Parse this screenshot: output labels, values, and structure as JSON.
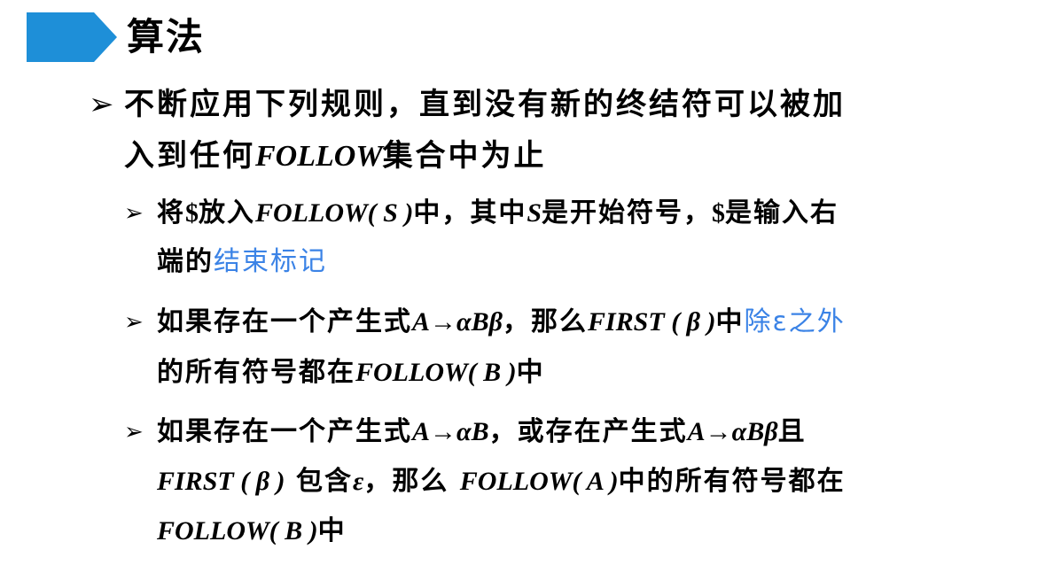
{
  "slide": {
    "title": "算法",
    "bullet_main": {
      "line1": "不断应用下列规则，直到没有新的终结符可以被加",
      "line2_a": "入到任何",
      "line2_follow": "FOLLOW",
      "line2_b": "集合中为止"
    },
    "rule1": {
      "a": "将",
      "dollar": "$",
      "b": "放入",
      "follow_s": "FOLLOW( S )",
      "c": "中，其中",
      "s": "S",
      "d": "是开始符号，",
      "dollar2": "$",
      "e": "是输入右",
      "f": "端的",
      "highlight": "结束标记"
    },
    "rule2": {
      "a": "如果存在一个产生式",
      "prod": "A→αBβ",
      "b": "，那么",
      "first": "FIRST ( β )",
      "c": "中",
      "highlight": "除ε之外",
      "d": "的所有符号都在",
      "follow_b": "FOLLOW( B )",
      "e": "中"
    },
    "rule3": {
      "a": "如果存在一个产生式",
      "prod1": "A→αB",
      "b": "，或存在产生式",
      "prod2": "A→αBβ",
      "c": "且",
      "first": "FIRST ( β )",
      "d": "包含",
      "eps": "ε",
      "e": "，那么 ",
      "follow_a": "FOLLOW( A )",
      "f": "中的所有符号都在",
      "follow_b": "FOLLOW( B )",
      "g": "中"
    },
    "colors": {
      "banner": "#1e8fd8",
      "highlight": "#3b83e6"
    },
    "icons": {
      "bullet": "arrow-bullet-icon",
      "banner": "pentagon-banner-icon"
    }
  }
}
